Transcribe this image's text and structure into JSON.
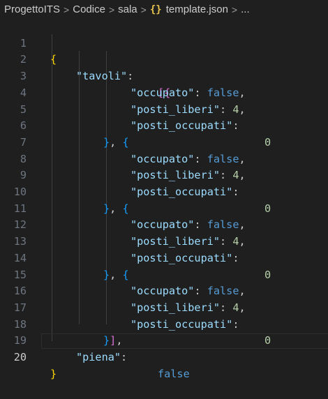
{
  "breadcrumb": {
    "items": [
      "ProgettoITS",
      "Codice",
      "sala",
      "template.json",
      "..."
    ],
    "json_icon": "{}",
    "separator": ">"
  },
  "editor": {
    "lines": [
      {
        "n": "1"
      },
      {
        "n": "2"
      },
      {
        "n": "3"
      },
      {
        "n": "4"
      },
      {
        "n": "5"
      },
      {
        "n": "6"
      },
      {
        "n": "7"
      },
      {
        "n": "8"
      },
      {
        "n": "9"
      },
      {
        "n": "10"
      },
      {
        "n": "11"
      },
      {
        "n": "12"
      },
      {
        "n": "13"
      },
      {
        "n": "14"
      },
      {
        "n": "15"
      },
      {
        "n": "16"
      },
      {
        "n": "17"
      },
      {
        "n": "18"
      },
      {
        "n": "19"
      },
      {
        "n": "20"
      }
    ],
    "active_line": "20",
    "tokens": {
      "open_brace": "{",
      "close_brace": "}",
      "tavoli_key": "\"tavoli\"",
      "piena_key": "\"piena\"",
      "occupato_key": "\"occupato\"",
      "posti_liberi_key": "\"posti_liberi\"",
      "posti_occupati_key": "\"posti_occupati\"",
      "false": "false",
      "four": "4",
      "zero": "0",
      "array_open": "[{",
      "obj_sep_close": "}",
      "obj_sep_comma": ", ",
      "obj_sep_open": "{",
      "array_close_brace": "}",
      "array_close_bracket": "]",
      "colon": ":",
      "comma": ","
    }
  },
  "colors": {
    "background": "#1f1f1f",
    "key": "#9cdcfe",
    "keyword": "#569cd6",
    "number": "#b5cea8",
    "bracket_level_1": "#ffd700",
    "bracket_level_2": "#da70d6",
    "bracket_level_3": "#179fff"
  }
}
